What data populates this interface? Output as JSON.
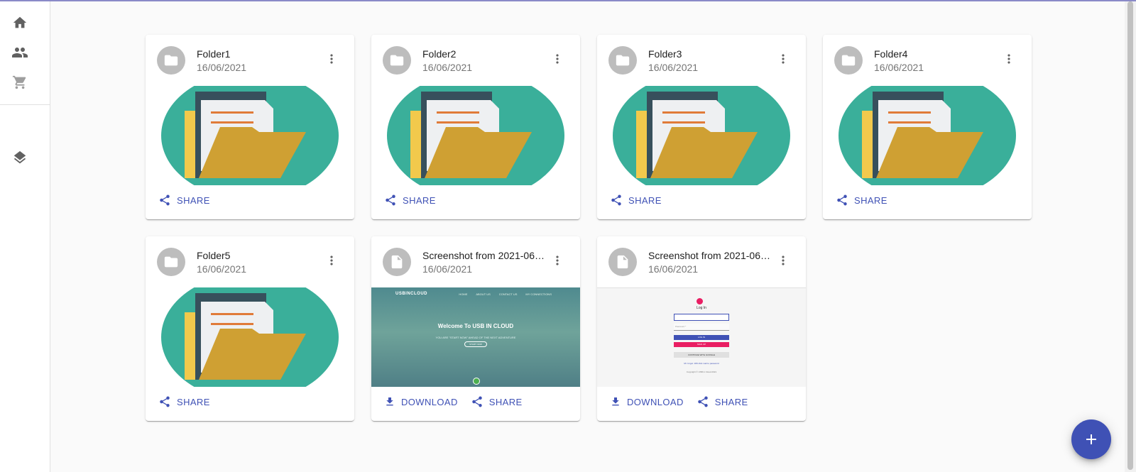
{
  "colors": {
    "primary": "#3f51b5",
    "avatar_bg": "#bdbdbd",
    "folder_circle": "#3aaf9a",
    "folder_yellow": "#cfa033"
  },
  "sidebar": {
    "items": [
      {
        "icon": "home-icon"
      },
      {
        "icon": "people-icon"
      },
      {
        "icon": "shopping-cart-icon"
      },
      {
        "icon": "layers-icon"
      }
    ]
  },
  "cards": [
    {
      "type": "folder",
      "title": "Folder1",
      "date": "16/06/2021",
      "actions": [
        "SHARE"
      ]
    },
    {
      "type": "folder",
      "title": "Folder2",
      "date": "16/06/2021",
      "actions": [
        "SHARE"
      ]
    },
    {
      "type": "folder",
      "title": "Folder3",
      "date": "16/06/2021",
      "actions": [
        "SHARE"
      ]
    },
    {
      "type": "folder",
      "title": "Folder4",
      "date": "16/06/2021",
      "actions": [
        "SHARE"
      ]
    },
    {
      "type": "folder",
      "title": "Folder5",
      "date": "16/06/2021",
      "actions": [
        "SHARE"
      ]
    },
    {
      "type": "file",
      "title": "Screenshot from 2021-06-...",
      "date": "16/06/2021",
      "actions": [
        "DOWNLOAD",
        "SHARE"
      ]
    },
    {
      "type": "file",
      "title": "Screenshot from 2021-06-...",
      "date": "16/06/2021",
      "actions": [
        "DOWNLOAD",
        "SHARE"
      ]
    }
  ],
  "preview_web": {
    "brand": "USBINCLOUD",
    "menu": [
      "HOME",
      "ABOUT US",
      "CONTACT US",
      "MY CONNECTIONS"
    ],
    "welcome": "Welcome To USB IN CLOUD",
    "tagline": "YOU ARE \"START NOW\" AHEAD OF THE NEXT ADVENTURE",
    "cta": "START NOW"
  },
  "preview_login": {
    "title": "Log In",
    "password_placeholder": "Password *",
    "login_btn": "LOG IN",
    "signup_btn": "SIGN UP",
    "google_btn": "CONTINUE WITH GOOGLE",
    "forgot_link": "Mr. forgot. Will click mail to password",
    "copyright": "Copyright © USB in Cloud 2021"
  },
  "fab": {
    "icon": "add-icon"
  }
}
